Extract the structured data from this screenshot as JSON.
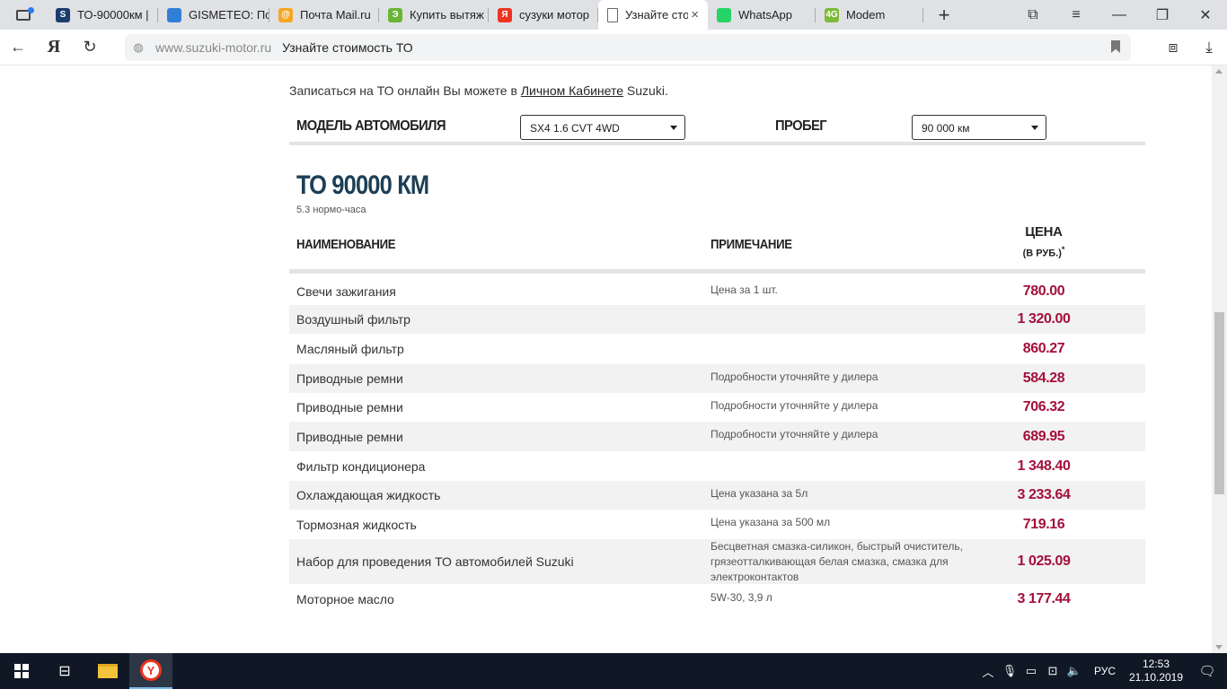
{
  "browser": {
    "tabs": [
      {
        "title": "ТО-90000км | ",
        "icon": "suzuki-icon",
        "color": "#1a3d6e",
        "glyph": "S",
        "width": 124
      },
      {
        "title": "GISMETEO: По",
        "icon": "gismeteo-drop-icon",
        "color": "#2f7fd6",
        "glyph": "",
        "width": 124
      },
      {
        "title": "Почта Mail.ru",
        "icon": "mailru-icon",
        "color": "#f5a623",
        "glyph": "@",
        "width": 122
      },
      {
        "title": "Купить вытяж",
        "icon": "market-icon",
        "color": "#6bb536",
        "glyph": "Э",
        "width": 122
      },
      {
        "title": "сузуки мотор",
        "icon": "yandex-icon",
        "color": "#e32",
        "glyph": "Я",
        "width": 122
      },
      {
        "title": "Узнайте сто",
        "icon": "page-icon",
        "color": "#ffffff",
        "glyph": "",
        "width": 122,
        "active": true,
        "close": "×"
      },
      {
        "title": "WhatsApp",
        "icon": "whatsapp-icon",
        "color": "#25d366",
        "glyph": "",
        "width": 120
      },
      {
        "title": "Modem",
        "icon": "modem-4g-icon",
        "color": "#7cba3b",
        "glyph": "4G",
        "width": 120
      }
    ],
    "new_tab": "+",
    "address": {
      "host": "www.suzuki-motor.ru",
      "title": "Узнайте стоимость ТО"
    }
  },
  "page": {
    "intro_before": "Записаться на ТО онлайн Вы можете в ",
    "intro_link": "Личном Кабинете",
    "intro_after": " Suzuki.",
    "model_label": "МОДЕЛЬ АВТОМОБИЛЯ",
    "model_value": "SX4 1.6 CVT 4WD",
    "mileage_label": "ПРОБЕГ",
    "mileage_value": "90 000 км",
    "to_title": "ТО 90000 КМ",
    "to_subtitle": "5.3 нормо-часа",
    "col_name": "НАИМЕНОВАНИЕ",
    "col_note": "ПРИМЕЧАНИЕ",
    "col_price": "ЦЕНА",
    "col_price_unit": "(В РУБ.)",
    "col_price_mark": "*",
    "rows": [
      {
        "name": "Свечи зажигания",
        "note": "Цена за 1 шт.",
        "price": "780.00"
      },
      {
        "name": "Воздушный фильтр",
        "note": "",
        "price": "1 320.00"
      },
      {
        "name": "Масляный фильтр",
        "note": "",
        "price": "860.27"
      },
      {
        "name": "Приводные ремни",
        "note": "Подробности уточняйте у дилера",
        "price": "584.28"
      },
      {
        "name": "Приводные ремни",
        "note": "Подробности уточняйте у дилера",
        "price": "706.32"
      },
      {
        "name": "Приводные ремни",
        "note": "Подробности уточняйте у дилера",
        "price": "689.95"
      },
      {
        "name": "Фильтр кондиционера",
        "note": "",
        "price": "1 348.40"
      },
      {
        "name": "Охлаждающая жидкость",
        "note": "Цена указана за 5л",
        "price": "3 233.64"
      },
      {
        "name": "Тормозная жидкость",
        "note": "Цена указана за 500 мл",
        "price": "719.16"
      },
      {
        "name": "Набор для проведения ТО автомобилей Suzuki",
        "note": "Бесцветная смазка-силикон, быстрый очиститель, грязеотталкивающая белая смазка, смазка для электроконтактов",
        "price": "1 025.09"
      },
      {
        "name": "Моторное масло",
        "note": "5W-30, 3,9 л",
        "price": "3 177.44"
      }
    ],
    "price_color": "#a3103c",
    "title_color": "#1c3f55"
  },
  "taskbar": {
    "lang": "РУС",
    "time": "12:53",
    "date": "21.10.2019"
  }
}
